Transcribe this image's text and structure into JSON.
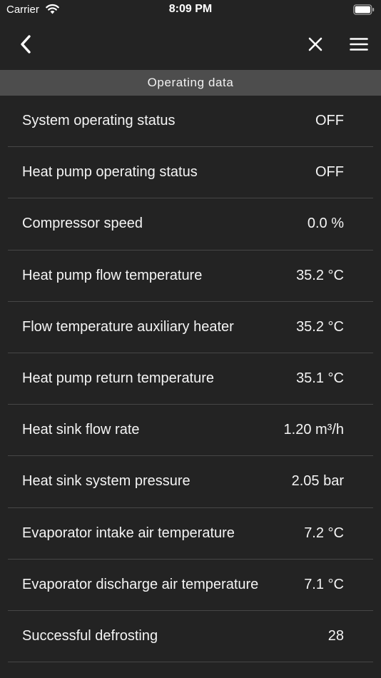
{
  "status_bar": {
    "carrier": "Carrier",
    "time": "8:09 PM"
  },
  "nav": {
    "back_icon": "chevron-left-icon",
    "close_icon": "close-icon",
    "menu_icon": "hamburger-menu-icon"
  },
  "section": {
    "title": "Operating data"
  },
  "rows": [
    {
      "label": "System operating status",
      "value": "OFF"
    },
    {
      "label": "Heat pump operating status",
      "value": "OFF"
    },
    {
      "label": "Compressor speed",
      "value": "0.0 %"
    },
    {
      "label": "Heat pump flow temperature",
      "value": "35.2 °C"
    },
    {
      "label": "Flow temperature auxiliary heater",
      "value": "35.2 °C"
    },
    {
      "label": "Heat pump return temperature",
      "value": "35.1 °C"
    },
    {
      "label": "Heat sink flow rate",
      "value": "1.20 m³/h"
    },
    {
      "label": "Heat sink system pressure",
      "value": "2.05 bar"
    },
    {
      "label": "Evaporator intake air temperature",
      "value": "7.2 °C"
    },
    {
      "label": "Evaporator discharge air temperature",
      "value": "7.1 °C"
    },
    {
      "label": "Successful defrosting",
      "value": "28"
    }
  ],
  "colors": {
    "background": "#232323",
    "section_header": "#4d4d4d",
    "divider": "#464646",
    "text": "#ffffff"
  }
}
